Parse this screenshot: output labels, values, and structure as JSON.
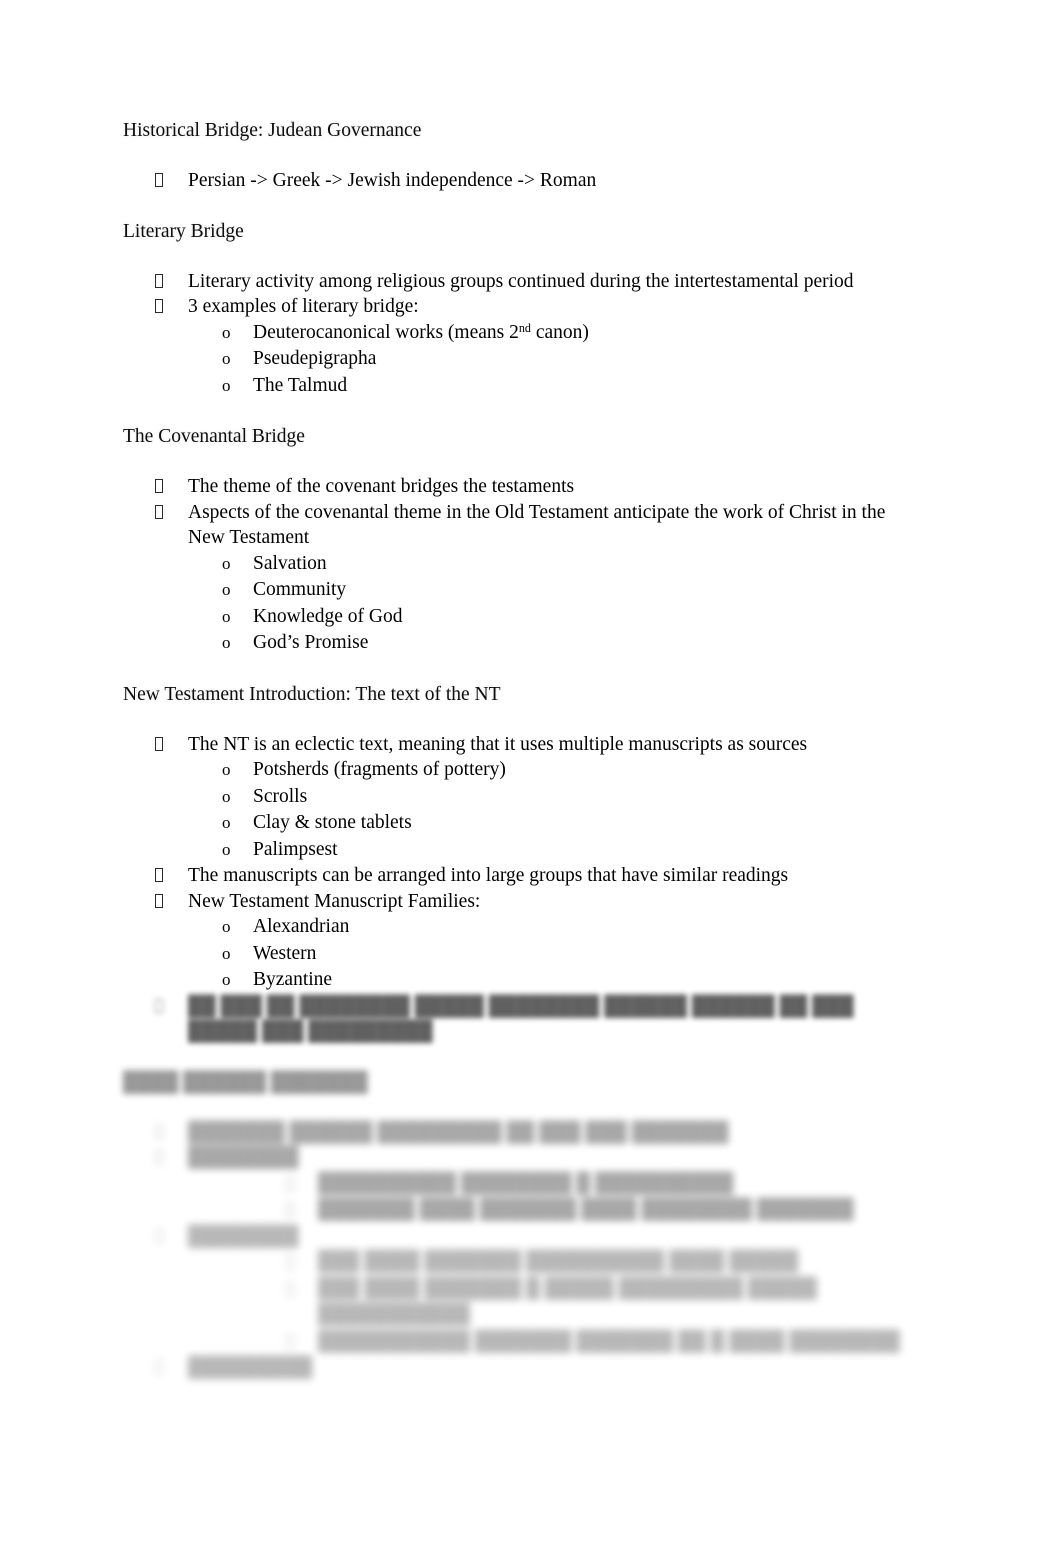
{
  "document": {
    "type": "study-notes",
    "page_background": "#ffffff",
    "text_color": "#000000",
    "bullet_glyph": "tofu-box",
    "sub_bullet_glyph": "o"
  },
  "sections": [
    {
      "heading": "Historical Bridge: Judean Governance",
      "items": [
        {
          "level": 1,
          "text": "Persian -> Greek -> Jewish independence -> Roman"
        }
      ]
    },
    {
      "heading": "Literary Bridge",
      "items": [
        {
          "level": 1,
          "text": "Literary activity among religious groups continued during the intertestamental period"
        },
        {
          "level": 1,
          "text": "3 examples of literary bridge:"
        },
        {
          "level": 2,
          "text_pre": "Deuterocanonical works (means 2",
          "sup": "nd",
          "text_post": " canon)"
        },
        {
          "level": 2,
          "text": "Pseudepigrapha"
        },
        {
          "level": 2,
          "text": "The Talmud"
        }
      ]
    },
    {
      "heading": "The Covenantal Bridge",
      "items": [
        {
          "level": 1,
          "text": "The theme of the covenant bridges the testaments"
        },
        {
          "level": 1,
          "text": "Aspects of the covenantal theme in the Old Testament anticipate the work of Christ in the New Testament"
        },
        {
          "level": 2,
          "text": "Salvation"
        },
        {
          "level": 2,
          "text": "Community"
        },
        {
          "level": 2,
          "text": "Knowledge of God"
        },
        {
          "level": 2,
          "text": "God’s Promise"
        }
      ]
    },
    {
      "heading": "New Testament Introduction: The text of the NT",
      "items": [
        {
          "level": 1,
          "text": "The NT is an eclectic text, meaning that it uses multiple manuscripts as sources"
        },
        {
          "level": 2,
          "text": "Potsherds (fragments of pottery)"
        },
        {
          "level": 2,
          "text": "Scrolls"
        },
        {
          "level": 2,
          "text": "Clay & stone tablets"
        },
        {
          "level": 2,
          "text": "Palimpsest"
        },
        {
          "level": 1,
          "text": "The manuscripts can be arranged into large groups that have similar readings"
        },
        {
          "level": 1,
          "text": "New Testament Manuscript Families:"
        },
        {
          "level": 2,
          "text": "Alexandrian"
        },
        {
          "level": 2,
          "text": "Western"
        },
        {
          "level": 2,
          "text": "Byzantine"
        }
      ]
    }
  ],
  "redacted": {
    "note": "lower portion of page is blurred and illegible",
    "trailing_item": {
      "level": 1,
      "text": "██ ███ ██ ████████ █████ ████████ ██████ ██████ ██ ███ █████ ███ █████████"
    },
    "heading": "████ ██████ ███████",
    "items": [
      {
        "level": 1,
        "text": "███████ ██████ █████████ ██ ███ ███ ███████"
      },
      {
        "level": 1,
        "text": "████████"
      },
      {
        "level": 3,
        "text": "██████████ ████████ █ ██████████"
      },
      {
        "level": 3,
        "text": "███████ ████ ███████ ████ ████████ ███████"
      },
      {
        "level": 1,
        "text": "████████"
      },
      {
        "level": 3,
        "text": "███ ████ ███████ ██████████ ████ █████"
      },
      {
        "level": 3,
        "text": "███ ████ ███████ █ █████ █████████ █████ ███████████"
      },
      {
        "level": 3,
        "text": "███████████ ███████ ███████ ██ █ ████ ████████"
      },
      {
        "level": 1,
        "text": "█████████"
      }
    ]
  }
}
